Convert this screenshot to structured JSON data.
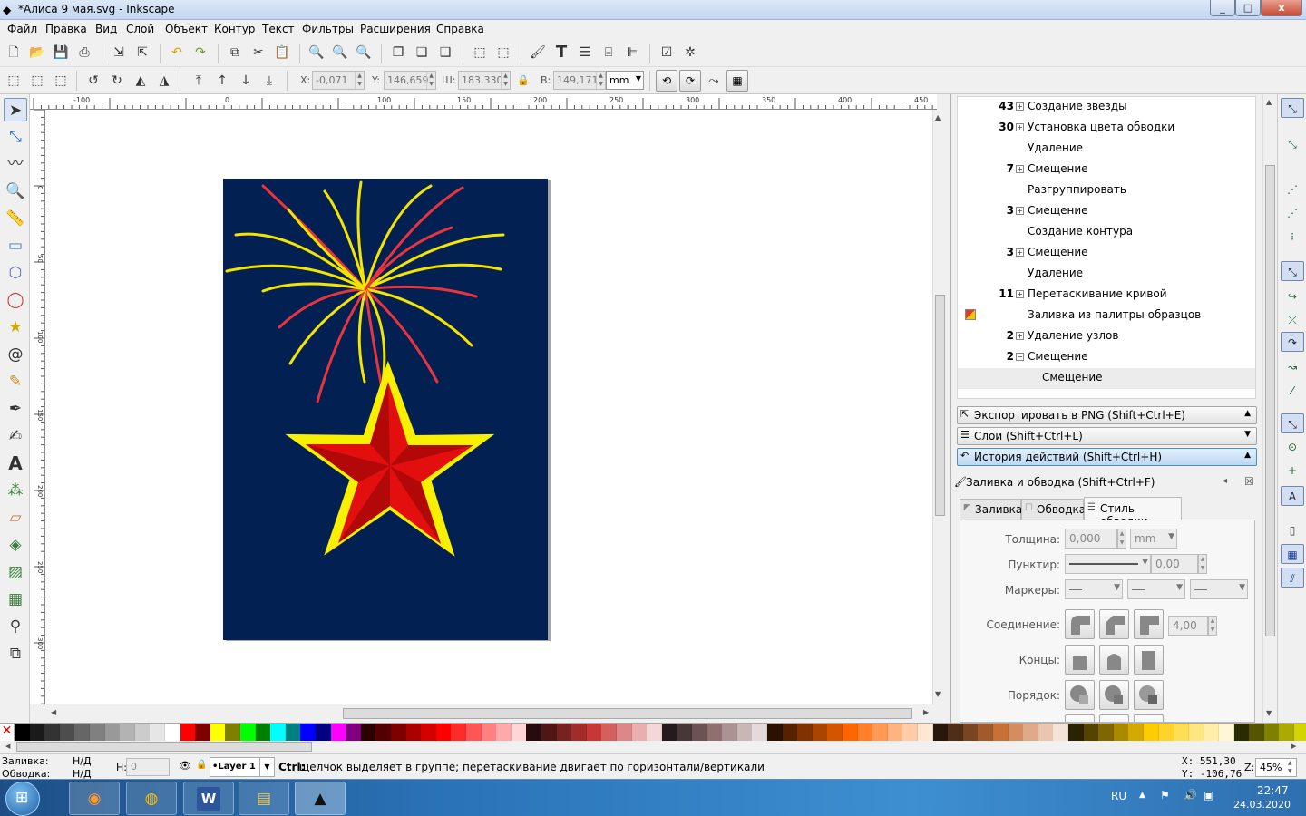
{
  "window": {
    "title": "*Алиса 9 мая.svg - Inkscape",
    "min": "_",
    "max": "□",
    "close": "x"
  },
  "menu": [
    "Файл",
    "Правка",
    "Вид",
    "Слой",
    "Объект",
    "Контур",
    "Текст",
    "Фильтры",
    "Расширения",
    "Справка"
  ],
  "toolbar2": {
    "x_label": "X:",
    "x_value": "-0,071",
    "y_label": "Y:",
    "y_value": "146,659",
    "w_label": "Ш:",
    "w_value": "183,330",
    "h_label": "В:",
    "h_value": "149,171",
    "unit": "mm"
  },
  "ruler_h": [
    "-100",
    "0",
    "100",
    "150",
    "200",
    "250",
    "300",
    "350",
    "400",
    "450"
  ],
  "ruler_v": [
    "0",
    "50",
    "100",
    "150",
    "200",
    "250",
    "300"
  ],
  "history": [
    {
      "count": "43",
      "expand": "⊞",
      "label": "Создание звезды"
    },
    {
      "count": "30",
      "expand": "⊞",
      "label": "Установка цвета обводки"
    },
    {
      "count": "",
      "expand": "",
      "label": "Удаление"
    },
    {
      "count": "7",
      "expand": "⊞",
      "label": "Смещение"
    },
    {
      "count": "",
      "expand": "",
      "label": "Разгруппировать"
    },
    {
      "count": "3",
      "expand": "⊞",
      "label": "Смещение"
    },
    {
      "count": "",
      "expand": "",
      "label": "Создание контура"
    },
    {
      "count": "3",
      "expand": "⊞",
      "label": "Смещение"
    },
    {
      "count": "",
      "expand": "",
      "label": "Удаление"
    },
    {
      "count": "11",
      "expand": "⊞",
      "label": "Перетаскивание кривой"
    },
    {
      "count": "",
      "expand": "",
      "label": "Заливка из палитры образцов"
    },
    {
      "count": "2",
      "expand": "⊞",
      "label": "Удаление узлов"
    },
    {
      "count": "2",
      "expand": "⊟",
      "label": "Смещение"
    },
    {
      "count": "",
      "expand": "",
      "label": "Смещение"
    }
  ],
  "panels": {
    "export": "Экспортировать в PNG (Shift+Ctrl+E)",
    "layers": "Слои (Shift+Ctrl+L)",
    "history": "История действий (Shift+Ctrl+H)",
    "fill_stroke": "Заливка и обводка (Shift+Ctrl+F)"
  },
  "fill_stroke": {
    "tabs": [
      "Заливка",
      "Обводка",
      "Стиль обводки"
    ],
    "width_label": "Толщина:",
    "width_value": "0,000",
    "width_unit": "mm",
    "dash_label": "Пунктир:",
    "dash_value": "0,00",
    "markers_label": "Маркеры:",
    "join_label": "Соединение:",
    "miter_value": "4,00",
    "caps_label": "Концы:",
    "order_label": "Порядок:"
  },
  "status": {
    "fill_label": "Заливка:",
    "fill_value": "Н/Д",
    "stroke_label": "Обводка:",
    "stroke_value": "Н/Д",
    "h_label": "Н:",
    "h_value": "0",
    "layer": "•Layer 1",
    "message_key": "Ctrl:",
    "message": " щелчок выделяет в группе; перетаскивание двигает по горизонтали/вертикали",
    "cursor_x": "X:  551,30",
    "cursor_y": "Y: -106,76",
    "zoom_label": "Z:",
    "zoom": "45%"
  },
  "taskbar": {
    "lang": "RU",
    "time": "22:47",
    "date": "24.03.2020",
    "word_label": "W"
  },
  "palette": [
    "#000000",
    "#1a1a1a",
    "#333333",
    "#4d4d4d",
    "#666666",
    "#808080",
    "#999999",
    "#b3b3b3",
    "#cccccc",
    "#e6e6e6",
    "#ffffff",
    "#ff0000",
    "#800000",
    "#ffff00",
    "#808000",
    "#00ff00",
    "#008000",
    "#00ffff",
    "#008080",
    "#0000ff",
    "#000080",
    "#ff00ff",
    "#800080",
    "#2b0000",
    "#550000",
    "#800000",
    "#aa0000",
    "#d40000",
    "#ff0000",
    "#ff2a2a",
    "#ff5555",
    "#ff8080",
    "#ffaaaa",
    "#ffd5d5",
    "#280b0b",
    "#501616",
    "#782121",
    "#a02c2c",
    "#c83737",
    "#d35f5f",
    "#de8787",
    "#e9afaf",
    "#f4d7d7",
    "#241c1c",
    "#483737",
    "#6c5353",
    "#916f6f",
    "#ac9393",
    "#c8b7b7",
    "#e3dbdb",
    "#2b1100",
    "#552200",
    "#803300",
    "#aa4400",
    "#d45500",
    "#ff6600",
    "#ff7f2a",
    "#ff9955",
    "#ffb380",
    "#ffccaa",
    "#ffe6d5",
    "#28170b",
    "#502d16",
    "#784421",
    "#a05a2c",
    "#c87137",
    "#d38d5f",
    "#deaa87",
    "#e9c6af",
    "#f4e3d7",
    "#2b2200",
    "#554400",
    "#806600",
    "#aa8800",
    "#d4aa00",
    "#ffcc00",
    "#ffd42a",
    "#ffdd55",
    "#ffe680",
    "#ffeeaa",
    "#fff6d5",
    "#2b2b00",
    "#555500",
    "#808000",
    "#aaaa00",
    "#d4d400"
  ]
}
